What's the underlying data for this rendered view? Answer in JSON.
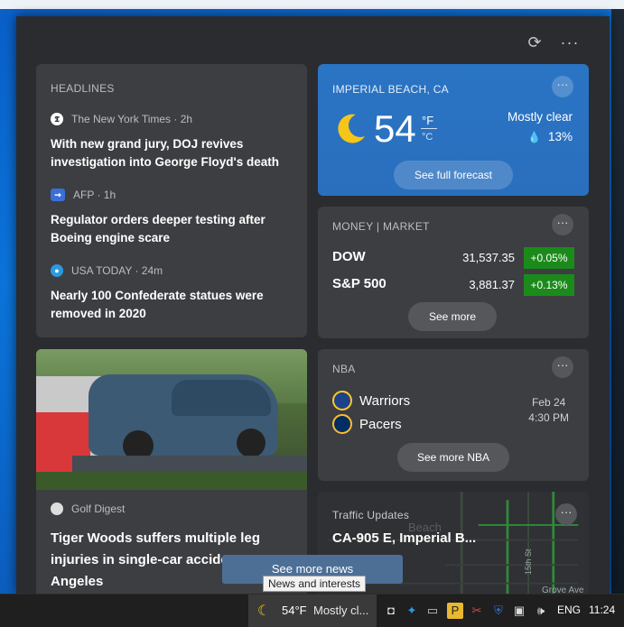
{
  "headlines": {
    "label": "HEADLINES",
    "items": [
      {
        "source": "The New York Times · 2h",
        "title_line1": "With new grand jury, DOJ revives",
        "title_line2": "investigation into George Floyd's death"
      },
      {
        "source": "AFP · 1h",
        "title_line1": "Regulator orders deeper testing after",
        "title_line2": "Boeing engine scare"
      },
      {
        "source": "USA TODAY · 24m",
        "title_line1": "Nearly 100 Confederate statues were",
        "title_line2": "removed in 2020"
      }
    ]
  },
  "weather": {
    "location": "IMPERIAL BEACH, CA",
    "temperature": "54",
    "unit_f": "°F",
    "unit_c": "°C",
    "condition": "Mostly clear",
    "precip": "13%",
    "forecast_button": "See full forecast",
    "icon": "moon-icon"
  },
  "market": {
    "label": "MONEY | MARKET",
    "rows": [
      {
        "name": "DOW",
        "value": "31,537.35",
        "change": "+0.05%"
      },
      {
        "name": "S&P 500",
        "value": "3,881.37",
        "change": "+0.13%"
      }
    ],
    "more_button": "See more",
    "positive_color": "#1b8a1b"
  },
  "nba": {
    "label": "NBA",
    "team1": "Warriors",
    "team2": "Pacers",
    "date": "Feb 24",
    "time": "4:30 PM",
    "more_button": "See more NBA"
  },
  "news_card": {
    "source": "Golf Digest",
    "title_line1": "Tiger Woods suffers multiple leg",
    "title_line2": "injuries in single-car accide",
    "title_line3": "Angeles"
  },
  "traffic": {
    "label": "Traffic Updates",
    "road": "CA-905 E, Imperial B...",
    "map_text_beach": "Beach",
    "map_text_grove": "Grove Ave",
    "map_text_15th": "15th St"
  },
  "see_more_news": "See more news",
  "tooltip": "News and interests",
  "taskbar": {
    "weather_temp": "54°F",
    "weather_text": "Mostly cl...",
    "language": "ENG",
    "clock": "11:24"
  }
}
